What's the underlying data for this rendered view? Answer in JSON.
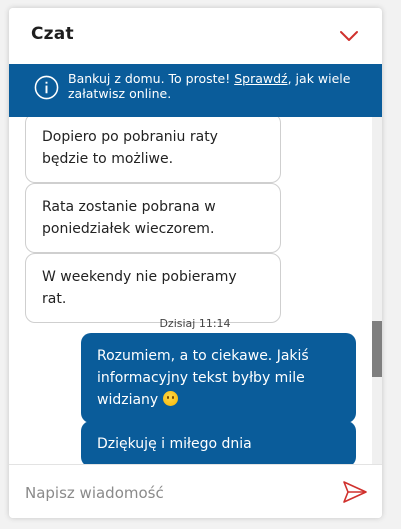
{
  "header": {
    "title": "Czat",
    "collapse_icon": "chevron-down-icon",
    "accent_color": "#d0312d"
  },
  "banner": {
    "icon": "info-icon",
    "text_before": "Bankuj z domu. To proste! ",
    "link_label": "Sprawdź",
    "text_after": ", jak wiele załatwisz online.",
    "background_color": "#0a5c9a"
  },
  "messages": {
    "incoming": [
      {
        "text": "Dopiero po pobraniu raty będzie to możliwe."
      },
      {
        "text": "Rata zostanie pobrana w poniedziałek wieczorem."
      },
      {
        "text": "W weekendy nie pobieramy rat."
      }
    ],
    "timestamp": "Dzisiaj 11:14",
    "outgoing": [
      {
        "text": "Rozumiem, a to ciekawe. Jakiś informacyjny tekst byłby mile widziany",
        "emoji": "slightly-smiling-face"
      },
      {
        "text": "Dziękuję i miłego dnia"
      }
    ]
  },
  "composer": {
    "placeholder": "Napisz wiadomość",
    "value": "",
    "send_icon": "send-icon"
  }
}
